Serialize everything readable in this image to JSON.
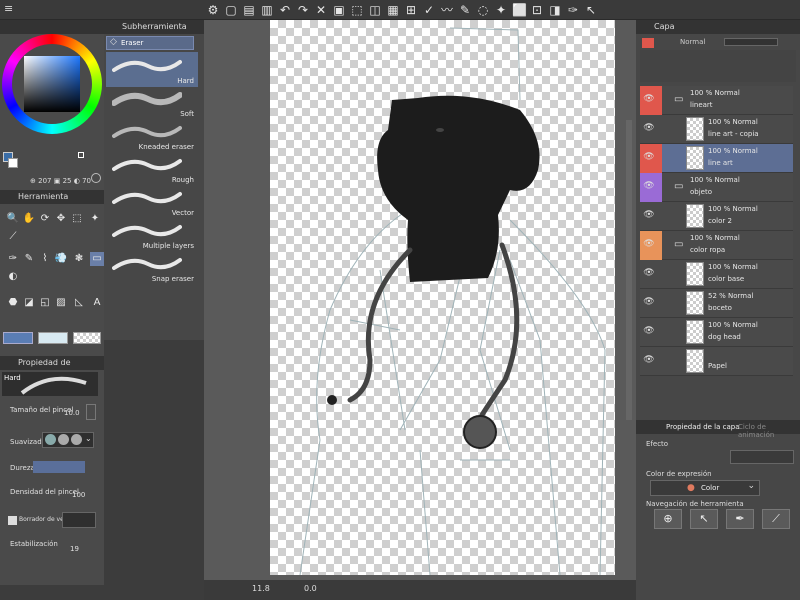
{
  "toolbar": {
    "icons": [
      "app-icon",
      "new-icon",
      "open-icon",
      "save-icon",
      "undo-icon",
      "redo-icon",
      "clear-icon",
      "fill-icon",
      "transform-icon",
      "selection-icon",
      "ruler-icon",
      "snap-icon",
      "line-icon",
      "curve-icon",
      "brush-icon",
      "lasso-icon",
      "wand-icon",
      "select-all-icon",
      "deselect-icon",
      "invert-icon",
      "pen-icon",
      "move-icon"
    ]
  },
  "color": {
    "values": {
      "h": "207",
      "s": "25",
      "v": "70"
    },
    "main_color": "#3b6ea8",
    "sub_color": "#ffffff"
  },
  "subtool": {
    "header": "Subherramienta [Eraser]",
    "group": "Eraser",
    "brushes": [
      {
        "label": "Hard"
      },
      {
        "label": "Soft"
      },
      {
        "label": "Kneaded eraser"
      },
      {
        "label": "Rough"
      },
      {
        "label": "Vector"
      },
      {
        "label": "Multiple layers"
      },
      {
        "label": "Snap eraser"
      }
    ]
  },
  "tools": {
    "header": "Herramienta"
  },
  "tool_property": {
    "header": "Propiedad de herram. [Hard]",
    "preset": "Hard",
    "brush_size_label": "Tamaño del pincel",
    "brush_size_value": "10.0",
    "smoothing_label": "Suavizado",
    "hardness_label": "Dureza",
    "density_label": "Densidad del pincel",
    "density_value": "100",
    "vector_eraser_label": "Borrador de vector",
    "stabilization_label": "Estabilización",
    "stabilization_value": "19"
  },
  "canvas": {
    "zoom": "11.8",
    "angle": "0.0"
  },
  "layer_panel": {
    "tab": "Capa",
    "blend_mode": "Normal",
    "layers": [
      {
        "mode": "100 % Normal",
        "name": "lineart",
        "folder": true,
        "tag_color": "#e0574c"
      },
      {
        "mode": "100 % Normal",
        "name": "line art - copia",
        "folder": false,
        "tag_color": ""
      },
      {
        "mode": "100 % Normal",
        "name": "line art",
        "folder": false,
        "tag_color": "#e0574c",
        "selected": true
      },
      {
        "mode": "100 % Normal",
        "name": "objeto",
        "folder": true,
        "tag_color": "#9a6bd6"
      },
      {
        "mode": "100 % Normal",
        "name": "color 2",
        "folder": false,
        "tag_color": ""
      },
      {
        "mode": "100 % Normal",
        "name": "color ropa",
        "folder": true,
        "tag_color": "#e8935a"
      },
      {
        "mode": "100 % Normal",
        "name": "color base",
        "folder": false,
        "tag_color": ""
      },
      {
        "mode": "52 % Normal",
        "name": "boceto",
        "folder": false,
        "tag_color": ""
      },
      {
        "mode": "100 % Normal",
        "name": "dog head",
        "folder": false,
        "tag_color": ""
      },
      {
        "mode": "",
        "name": "Papel",
        "folder": false,
        "tag_color": ""
      }
    ]
  },
  "layer_property": {
    "tab_active": "Propiedad de la capa",
    "tab_inactive": "Ciclo de animación",
    "effect_label": "Efecto",
    "expression_color_label": "Color de expresión",
    "expression_color_value": "Color",
    "tool_nav_label": "Navegación de herramienta"
  }
}
